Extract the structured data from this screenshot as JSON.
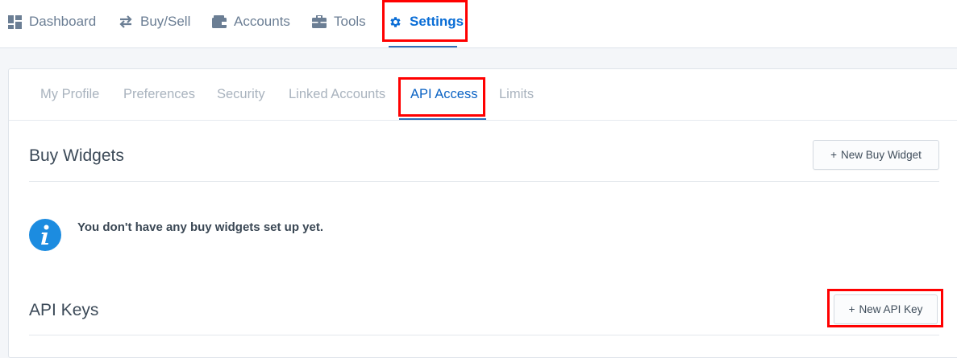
{
  "topnav": {
    "items": [
      {
        "label": "Dashboard",
        "icon": "dashboard-grid-icon"
      },
      {
        "label": "Buy/Sell",
        "icon": "swap-arrows-icon"
      },
      {
        "label": "Accounts",
        "icon": "wallet-icon"
      },
      {
        "label": "Tools",
        "icon": "toolbox-icon"
      },
      {
        "label": "Settings",
        "icon": "gear-icon"
      }
    ],
    "active": "Settings"
  },
  "settings": {
    "tabs": [
      {
        "label": "My Profile"
      },
      {
        "label": "Preferences"
      },
      {
        "label": "Security"
      },
      {
        "label": "Linked Accounts"
      },
      {
        "label": "API Access"
      },
      {
        "label": "Limits"
      }
    ],
    "active_tab": "API Access"
  },
  "buy_widgets": {
    "title": "Buy Widgets",
    "new_button": "New Buy Widget",
    "empty_message": "You don't have any buy widgets set up yet."
  },
  "api_keys": {
    "title": "API Keys",
    "new_button": "New API Key"
  },
  "colors": {
    "accent": "#0b6ed6",
    "highlight": "#ff0000",
    "info": "#1c8ce0"
  }
}
